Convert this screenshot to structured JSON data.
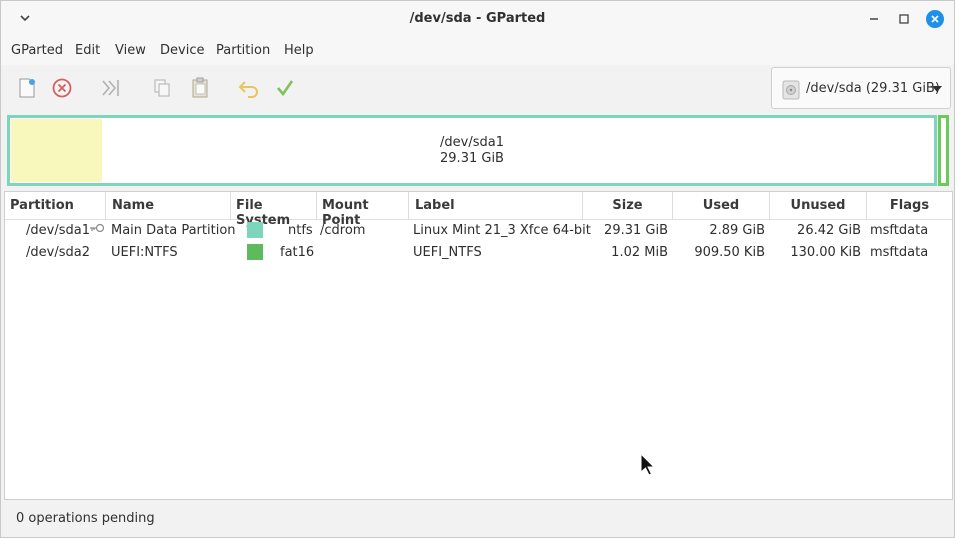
{
  "window": {
    "title": "/dev/sda - GParted"
  },
  "menubar": {
    "items": [
      "GParted",
      "Edit",
      "View",
      "Device",
      "Partition",
      "Help"
    ]
  },
  "toolbar": {
    "device_label": "/dev/sda (29.31 GiB)"
  },
  "disk_graphic": {
    "partition_name": "/dev/sda1",
    "partition_size": "29.31 GiB",
    "used_fraction": 0.0986,
    "colors": {
      "ntfs_border": "#7dd5bb",
      "fat16_border": "#6cc95e",
      "used_fill": "#f8f7bc"
    }
  },
  "table": {
    "headers": [
      "Partition",
      "Name",
      "File System",
      "Mount Point",
      "Label",
      "Size",
      "Used",
      "Unused",
      "Flags"
    ],
    "rows": [
      {
        "partition": "/dev/sda1",
        "name": "Main Data Partition",
        "fs_color": "#7dd5bb",
        "file_system": "ntfs",
        "mount_point": "/cdrom",
        "label": "Linux Mint 21_3 Xfce 64-bit",
        "size": "29.31 GiB",
        "used": "2.89 GiB",
        "unused": "26.42 GiB",
        "flags": "msftdata"
      },
      {
        "partition": "/dev/sda2",
        "name": "UEFI:NTFS",
        "fs_color": "#5dbb5d",
        "file_system": "fat16",
        "mount_point": "",
        "label": "UEFI_NTFS",
        "size": "1.02 MiB",
        "used": "909.50 KiB",
        "unused": "130.00 KiB",
        "flags": "msftdata"
      }
    ]
  },
  "status": {
    "text": "0 operations pending"
  }
}
